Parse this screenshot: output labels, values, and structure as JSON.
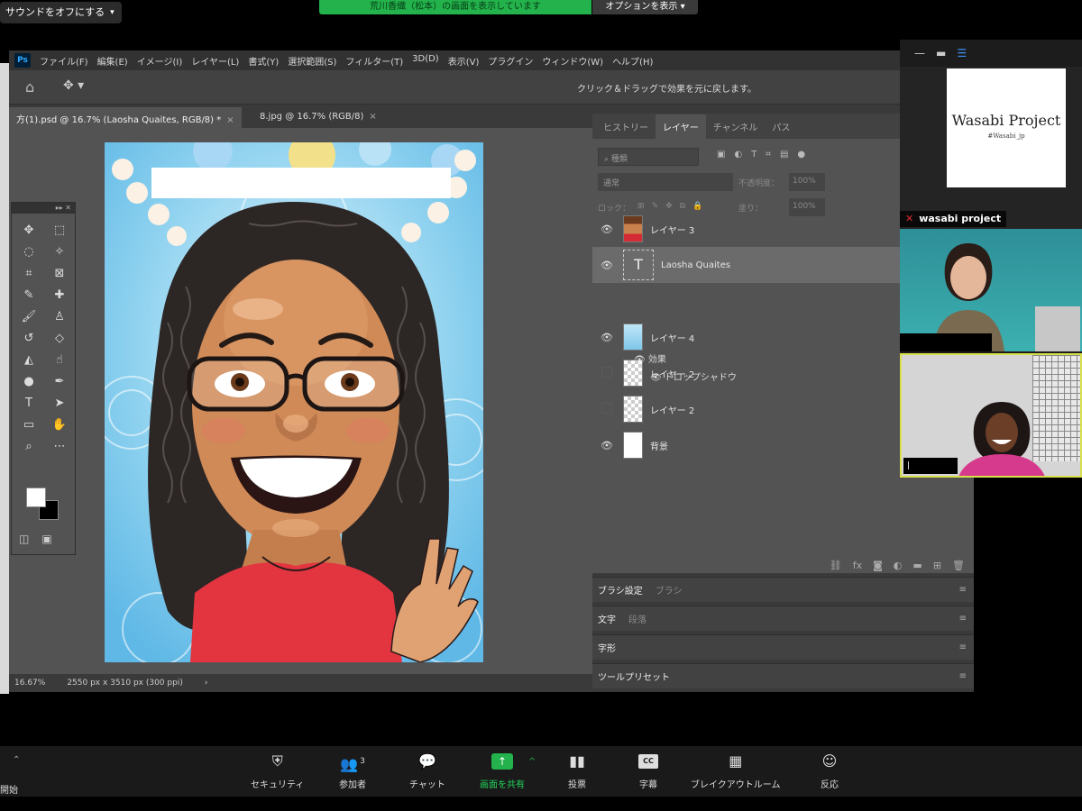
{
  "zoom_top": {
    "sound_button_label": "サウンドをオフにする",
    "share_banner": "荒川香織（松本）の画面を表示しています",
    "options_label": "オプションを表示"
  },
  "photoshop": {
    "menu": [
      "ファイル(F)",
      "編集(E)",
      "イメージ(I)",
      "レイヤー(L)",
      "書式(Y)",
      "選択範囲(S)",
      "フィルター(T)",
      "3D(D)",
      "表示(V)",
      "プラグイン",
      "ウィンドウ(W)",
      "ヘルプ(H)"
    ],
    "options_hint": "クリック＆ドラッグで効果を元に戻します。",
    "tabs": [
      {
        "label": "方(1).psd @ 16.7% (Laosha Quaites, RGB/8) *"
      },
      {
        "label": "8.jpg @ 16.7% (RGB/8)"
      }
    ],
    "status": {
      "zoom": "16.67%",
      "doc_size": "2550 px x 3510 px (300 ppi)"
    },
    "panel_tabs": [
      "ヒストリー",
      "レイヤー",
      "チャンネル",
      "パス"
    ],
    "layer_search_placeholder": "種類",
    "blend_mode": "通常",
    "opacity_label": "不透明度：",
    "opacity_value": "100%",
    "lock_label": "ロック：",
    "fill_label": "塗り：",
    "fill_value": "100%",
    "layers": [
      {
        "name": "レイヤー 3",
        "visible": true,
        "thumb": "caric"
      },
      {
        "name": "Laosha Quaites",
        "visible": true,
        "thumb": "type",
        "selected": true
      },
      {
        "name": "レイヤー 4",
        "visible": true,
        "thumb": "blue"
      },
      {
        "name": "レイヤー 2",
        "visible": false,
        "thumb": "trans"
      },
      {
        "name": "レイヤー 2",
        "visible": false,
        "thumb": "trans"
      },
      {
        "name": "背景",
        "visible": true,
        "thumb": "white"
      }
    ],
    "effects_label": "効果",
    "drop_shadow_label": "ドロップシャドウ",
    "brush_panel": {
      "active": "ブラシ設定",
      "inactive": "ブラシ"
    },
    "text_panel": {
      "active": "文字",
      "inactive": "段落"
    },
    "glyph_panel": "字形",
    "tool_presets_panel": "ツールプリセット"
  },
  "gallery": {
    "logo_title": "Wasabi Project",
    "logo_sub": "#Wasabi_jp",
    "name_tag": "wasabi project"
  },
  "zoom_toolbar": {
    "start_label": "開始",
    "security": "セキュリティ",
    "participants": "参加者",
    "participants_count": "3",
    "chat": "チャット",
    "share": "画面を共有",
    "poll": "投票",
    "captions": "字幕",
    "breakout": "ブレイクアウトルーム",
    "reactions": "反応",
    "cc": "CC"
  },
  "colors": {
    "share_green": "#23b24b",
    "ps_bg": "#535353",
    "ps_dark": "#323232",
    "speaker_highlight": "#d6e04a"
  }
}
